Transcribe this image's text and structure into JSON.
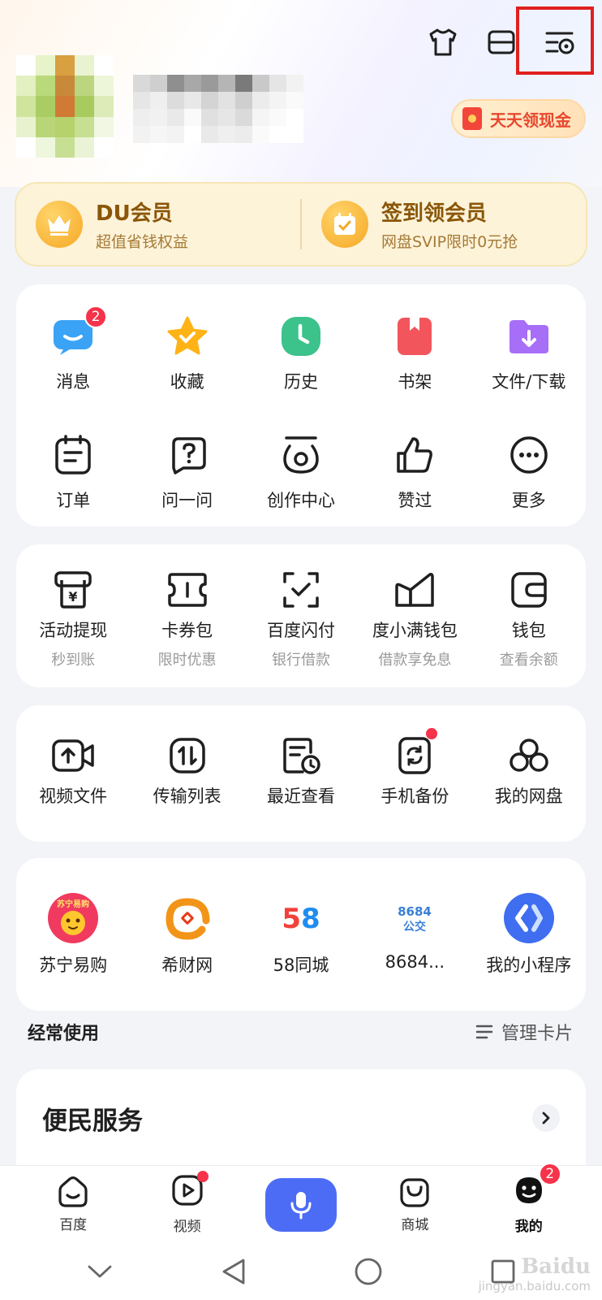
{
  "header": {
    "cash_pill": "天天领现金",
    "top_icons": [
      "tshirt-icon",
      "menu-icon",
      "settings-icon"
    ]
  },
  "vip": {
    "left": {
      "title": "DU会员",
      "subtitle": "超值省钱权益"
    },
    "right": {
      "title": "签到领会员",
      "subtitle": "网盘SVIP限时0元抢"
    }
  },
  "tools": [
    {
      "label": "消息",
      "badge": "2"
    },
    {
      "label": "收藏"
    },
    {
      "label": "历史"
    },
    {
      "label": "书架"
    },
    {
      "label": "文件/下载"
    },
    {
      "label": "订单"
    },
    {
      "label": "问一问"
    },
    {
      "label": "创作中心"
    },
    {
      "label": "赞过"
    },
    {
      "label": "更多"
    }
  ],
  "finance": [
    {
      "label": "活动提现",
      "sub": "秒到账"
    },
    {
      "label": "卡券包",
      "sub": "限时优惠"
    },
    {
      "label": "百度闪付",
      "sub": "银行借款"
    },
    {
      "label": "度小满钱包",
      "sub": "借款享免息"
    },
    {
      "label": "钱包",
      "sub": "查看余额"
    }
  ],
  "netdisk": [
    {
      "label": "视频文件"
    },
    {
      "label": "传输列表"
    },
    {
      "label": "最近查看"
    },
    {
      "label": "手机备份"
    },
    {
      "label": "我的网盘"
    }
  ],
  "mini_programs": [
    {
      "label": "苏宁易购",
      "logo_text": "苏宁易购"
    },
    {
      "label": "希财网"
    },
    {
      "label": "58同城",
      "logo_text": "58"
    },
    {
      "label": "8684...",
      "logo_text_1": "8684",
      "logo_text_2": "公交"
    },
    {
      "label": "我的小程序"
    }
  ],
  "frequent": {
    "title": "经常使用",
    "manage": "管理卡片"
  },
  "service_card": {
    "title": "便民服务"
  },
  "tabbar": [
    {
      "label": "百度"
    },
    {
      "label": "视频"
    },
    {
      "label": ""
    },
    {
      "label": "商城"
    },
    {
      "label": "我的",
      "badge": "2"
    }
  ],
  "watermark": {
    "brand": "Baidu",
    "sub": "jingyan.baidu.com"
  },
  "colors": {
    "accent": "#4c6cf6",
    "badge": "#f5334a",
    "vip_text": "#8a5608",
    "highlight": "#e0201f"
  }
}
